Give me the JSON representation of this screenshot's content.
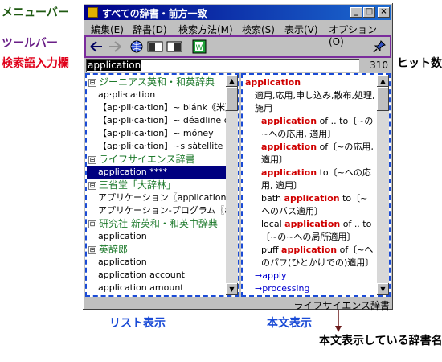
{
  "callouts": {
    "menu": "メニューバー",
    "tool": "ツールバー",
    "search": "検索語入力欄",
    "hits": "ヒット数",
    "list": "リスト表示",
    "body": "本文表示",
    "dict": "本文表示している辞書名"
  },
  "window": {
    "title": "すべての辞書・前方一致",
    "buttons": {
      "minimize": "_",
      "maximize": "□",
      "close": "×"
    }
  },
  "menu": [
    "編集(E)",
    "辞書(D)",
    "検索方法(M)",
    "検索(S)",
    "表示(V)",
    "オプション(O)"
  ],
  "toolbar": {
    "icons": [
      "back-icon",
      "forward-icon",
      "globe-icon",
      "list-view-icon",
      "text-view-icon",
      "dictionary-icon",
      "pin-icon"
    ]
  },
  "search": {
    "value": "application",
    "hit_count": "310"
  },
  "list": {
    "groups": [
      {
        "dict": "ジーニアス英和・和英辞典",
        "items": [
          "ap·pli·ca·tion",
          "【ap·pli·ca·tion】~ blánk《米》[",
          "【ap·pli·ca·tion】~ déadline d",
          "【ap·pli·ca·tion】~ móney",
          "【ap·pli·ca·tion】~s sàtellite"
        ]
      },
      {
        "dict": "ライフサイエンス辞書",
        "items": [
          "application ****"
        ]
      },
      {
        "dict": "三省堂「大辞林」",
        "items": [
          "アプリケーション〖application〗",
          "アプリケーション-プログラム〖a"
        ]
      },
      {
        "dict": "研究社 新英和・和英中辞典",
        "items": [
          "application"
        ]
      },
      {
        "dict": "英辞郎",
        "items": [
          "application",
          "application account",
          "application amount"
        ]
      }
    ],
    "expander": "⊟"
  },
  "body": {
    "headword": "application",
    "definition": "適用,応用,申し込み,散布,処理,施用",
    "examples": [
      {
        "kw": "application",
        "pre": "",
        "post": " of .. to〔~の~への応用, 適用〕"
      },
      {
        "kw": "application",
        "pre": "",
        "post": " of〔~の応用, 適用〕"
      },
      {
        "kw": "application",
        "pre": "",
        "post": " to〔~への応用, 適用〕"
      },
      {
        "kw": "application",
        "pre": "bath ",
        "post": " to〔~へのバス適用〕"
      },
      {
        "kw": "application",
        "pre": "local ",
        "post": " of .. to〔~の~への局所適用〕"
      },
      {
        "kw": "application",
        "pre": "puff ",
        "post": " of〔~へのパフ(ひとかけでの)適用〕"
      }
    ],
    "links": [
      "→apply",
      "→processing"
    ]
  },
  "status": {
    "dict_name": "ライフサイエンス辞書"
  },
  "colors": {
    "titlebar": "#000088",
    "dict_group": "#1e7a2c",
    "keyword": "#d00000",
    "selection": "#000080",
    "pane_border": "#1a4bd6",
    "toolbar_border": "#7a2c9c"
  }
}
